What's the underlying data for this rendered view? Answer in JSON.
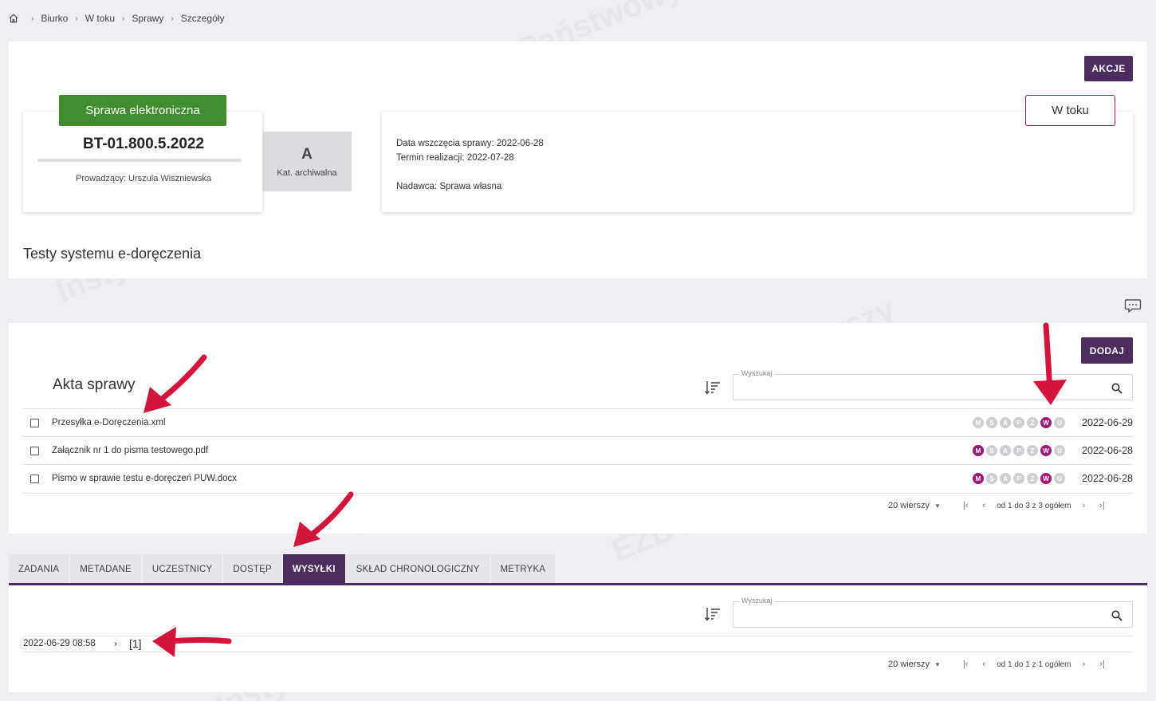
{
  "breadcrumb": {
    "items": [
      "Biurko",
      "W toku",
      "Sprawy",
      "Szczegóły"
    ]
  },
  "header": {
    "actions_label": "AKCJE"
  },
  "case": {
    "type_badge": "Sprawa elektroniczna",
    "number": "BT-01.800.5.2022",
    "lead": "Prowadzący: Urszula Wiszniewska",
    "archive_letter": "A",
    "archive_label": "Kat. archiwalna",
    "status": "W toku",
    "start_date": "Data wszczęcia sprawy:  2022-06-28",
    "deadline": "Termin realizacji:  2022-07-28",
    "sender": "Nadawca: Sprawa własna",
    "title": "Testy systemu e-doręczenia"
  },
  "files": {
    "title": "Akta sprawy",
    "add_label": "DODAJ",
    "search_label": "Wyszukaj",
    "rows": [
      {
        "name": "Przesyłka e-Doręczenia.xml",
        "date": "2022-06-29",
        "pills": [
          "M",
          "S",
          "A",
          "P",
          "Z",
          "W",
          "U"
        ],
        "active": [
          false,
          false,
          false,
          false,
          false,
          true,
          false
        ]
      },
      {
        "name": "Załącznik nr 1 do pisma testowego.pdf",
        "date": "2022-06-28",
        "pills": [
          "M",
          "S",
          "A",
          "P",
          "Z",
          "W",
          "U"
        ],
        "active": [
          true,
          false,
          false,
          false,
          false,
          true,
          false
        ]
      },
      {
        "name": "Pismo w sprawie testu e-doręczeń PUW.docx",
        "date": "2022-06-28",
        "pills": [
          "M",
          "S",
          "A",
          "P",
          "Z",
          "W",
          "U"
        ],
        "active": [
          true,
          false,
          false,
          false,
          false,
          true,
          false
        ]
      }
    ],
    "pager": {
      "rows": "20 wierszy",
      "range": "od 1 do 3 z 3 ogółem"
    }
  },
  "tabs": {
    "items": [
      "ZADANIA",
      "METADANE",
      "UCZESTNICY",
      "DOSTĘP",
      "WYSYŁKI",
      "SKŁAD CHRONOLOGICZNY",
      "METRYKA"
    ],
    "active_index": 4
  },
  "dispatch": {
    "search_label": "Wyszukaj",
    "row_datetime": "2022-06-29 08:58",
    "row_count": "[1]",
    "pager": {
      "rows": "20 wierszy",
      "range": "od 1 do 1 z 1 ogółem"
    }
  },
  "colors": {
    "accent": "#4b2d60",
    "green": "#3f8f2e",
    "pill_active": "#a3167a",
    "arrow": "#d2153d"
  }
}
